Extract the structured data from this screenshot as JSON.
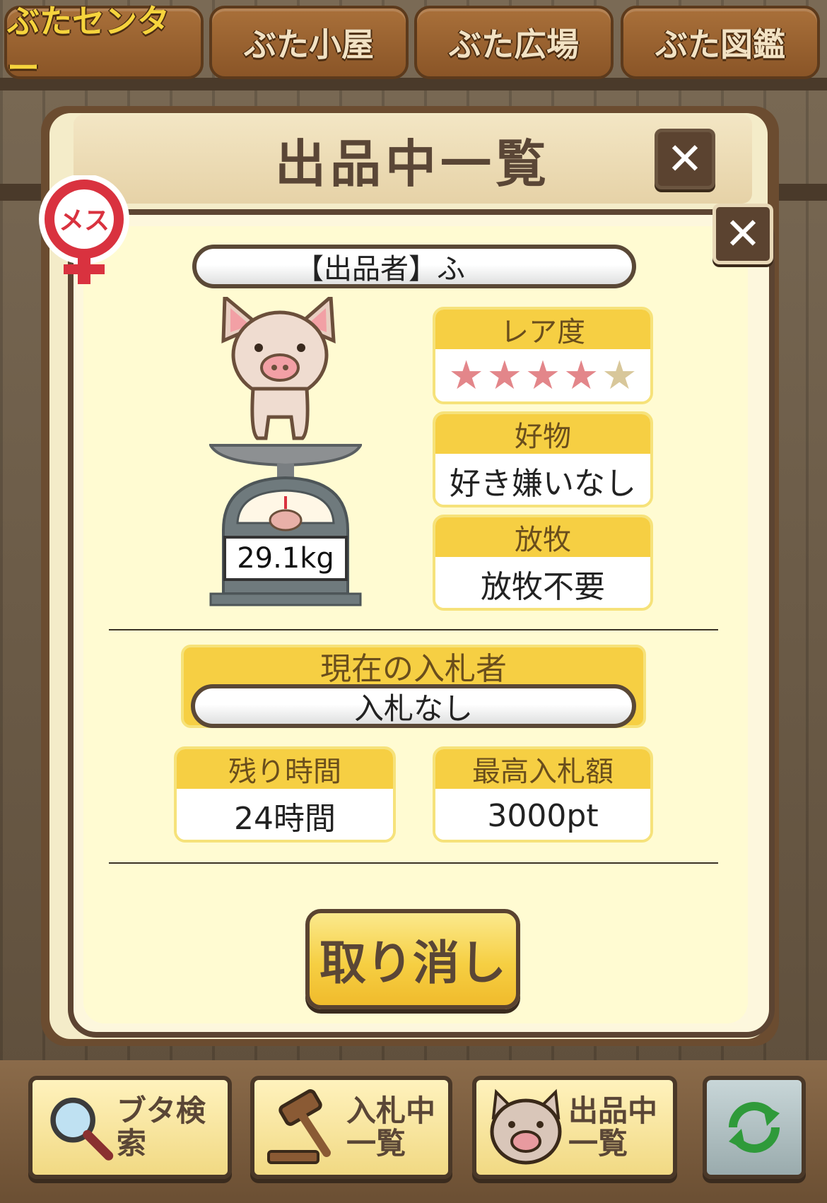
{
  "tabs": [
    {
      "label": "ぶたセンター",
      "active": true
    },
    {
      "label": "ぶた小屋",
      "active": false
    },
    {
      "label": "ぶた広場",
      "active": false
    },
    {
      "label": "ぶた図鑑",
      "active": false
    }
  ],
  "dialog": {
    "title": "出品中一覧",
    "close_icon": "✕"
  },
  "listing": {
    "gender": "メス",
    "seller_label": "【出品者】ふ",
    "weight": "29.1kg",
    "rarity": {
      "label": "レア度",
      "stars_filled": 4,
      "stars_total": 5
    },
    "favorite": {
      "label": "好物",
      "value": "好き嫌いなし"
    },
    "grazing": {
      "label": "放牧",
      "value": "放牧不要"
    },
    "current_bidder": {
      "label": "現在の入札者",
      "value": "入札なし"
    },
    "remaining_time": {
      "label": "残り時間",
      "value": "24時間"
    },
    "highest_bid": {
      "label": "最高入札額",
      "value": "3000pt"
    },
    "cancel_label": "取り消し"
  },
  "toolbar": {
    "search_label": "ブタ検索",
    "bidding_label_line1": "入札中",
    "bidding_label_line2": "一覧",
    "listing_label_line1": "出品中",
    "listing_label_line2": "一覧"
  },
  "colors": {
    "accent_yellow": "#f6cf43",
    "panel_bg": "#fffbd2",
    "wood_dark": "#5a4330",
    "star_filled": "#e3868a",
    "star_empty": "#d8c79a",
    "badge_red": "#d9323f"
  }
}
